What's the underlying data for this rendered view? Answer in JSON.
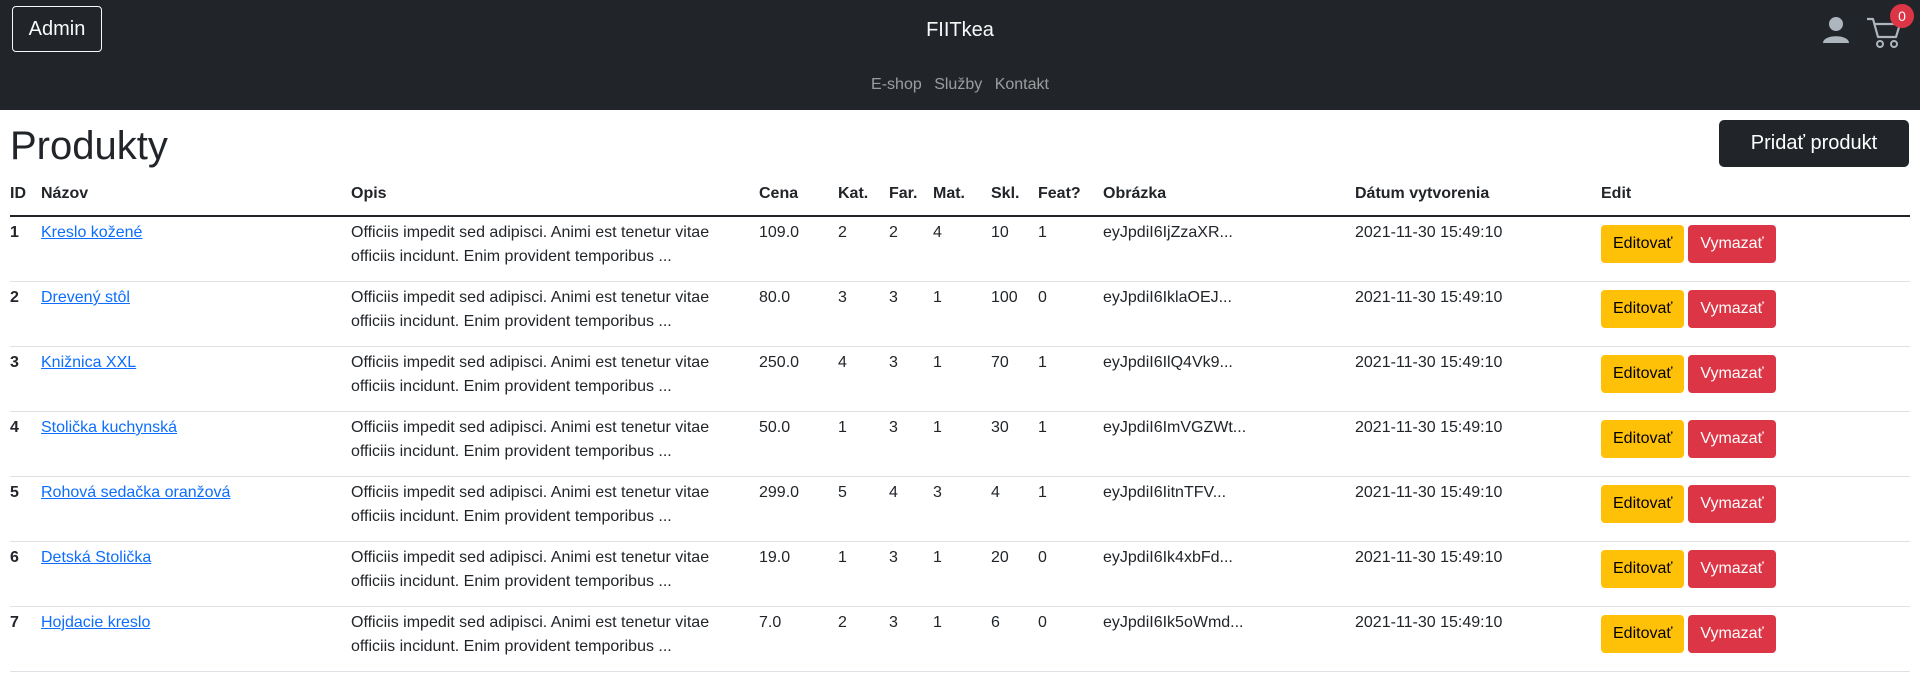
{
  "header": {
    "admin_label": "Admin",
    "brand": "FIITkea",
    "cart_count": "0",
    "nav": [
      "E-shop",
      "Služby",
      "Kontakt"
    ]
  },
  "main": {
    "title": "Produkty",
    "add_button": "Pridať produkt"
  },
  "table": {
    "headers": [
      "ID",
      "Názov",
      "Opis",
      "Cena",
      "Kat.",
      "Far.",
      "Mat.",
      "Skl.",
      "Feat?",
      "Obrázka",
      "Dátum vytvorenia",
      "Edit"
    ],
    "edit_label": "Editovať",
    "delete_label": "Vymazať",
    "rows": [
      {
        "id": "1",
        "name": "Kreslo kožené",
        "desc": "Officiis impedit sed adipisci. Animi est tenetur vitae officiis incidunt. Enim provident temporibus ...",
        "price": "109.0",
        "kat": "2",
        "far": "2",
        "mat": "4",
        "skl": "10",
        "feat": "1",
        "img": "eyJpdiI6IjZzaXR...",
        "date": "2021-11-30 15:49:10"
      },
      {
        "id": "2",
        "name": "Drevený stôl",
        "desc": "Officiis impedit sed adipisci. Animi est tenetur vitae officiis incidunt. Enim provident temporibus ...",
        "price": "80.0",
        "kat": "3",
        "far": "3",
        "mat": "1",
        "skl": "100",
        "feat": "0",
        "img": "eyJpdiI6IklaOEJ...",
        "date": "2021-11-30 15:49:10"
      },
      {
        "id": "3",
        "name": "Knižnica XXL",
        "desc": "Officiis impedit sed adipisci. Animi est tenetur vitae officiis incidunt. Enim provident temporibus ...",
        "price": "250.0",
        "kat": "4",
        "far": "3",
        "mat": "1",
        "skl": "70",
        "feat": "1",
        "img": "eyJpdiI6IlQ4Vk9...",
        "date": "2021-11-30 15:49:10"
      },
      {
        "id": "4",
        "name": "Stolička kuchynská",
        "desc": "Officiis impedit sed adipisci. Animi est tenetur vitae officiis incidunt. Enim provident temporibus ...",
        "price": "50.0",
        "kat": "1",
        "far": "3",
        "mat": "1",
        "skl": "30",
        "feat": "1",
        "img": "eyJpdiI6ImVGZWt...",
        "date": "2021-11-30 15:49:10"
      },
      {
        "id": "5",
        "name": "Rohová sedačka oranžová",
        "desc": "Officiis impedit sed adipisci. Animi est tenetur vitae officiis incidunt. Enim provident temporibus ...",
        "price": "299.0",
        "kat": "5",
        "far": "4",
        "mat": "3",
        "skl": "4",
        "feat": "1",
        "img": "eyJpdiI6IitnTFV...",
        "date": "2021-11-30 15:49:10"
      },
      {
        "id": "6",
        "name": "Detská Stolička",
        "desc": "Officiis impedit sed adipisci. Animi est tenetur vitae officiis incidunt. Enim provident temporibus ...",
        "price": "19.0",
        "kat": "1",
        "far": "3",
        "mat": "1",
        "skl": "20",
        "feat": "0",
        "img": "eyJpdiI6Ik4xbFd...",
        "date": "2021-11-30 15:49:10"
      },
      {
        "id": "7",
        "name": "Hojdacie kreslo",
        "desc": "Officiis impedit sed adipisci. Animi est tenetur vitae officiis incidunt. Enim provident temporibus ...",
        "price": "7.0",
        "kat": "2",
        "far": "3",
        "mat": "1",
        "skl": "6",
        "feat": "0",
        "img": "eyJpdiI6Ik5oWmd...",
        "date": "2021-11-30 15:49:10"
      }
    ]
  },
  "icons": {
    "user": "user-icon",
    "cart": "cart-icon"
  },
  "colors": {
    "navbar": "#212529",
    "edit": "#ffc107",
    "delete": "#dc3545",
    "link": "#0d6efd"
  }
}
